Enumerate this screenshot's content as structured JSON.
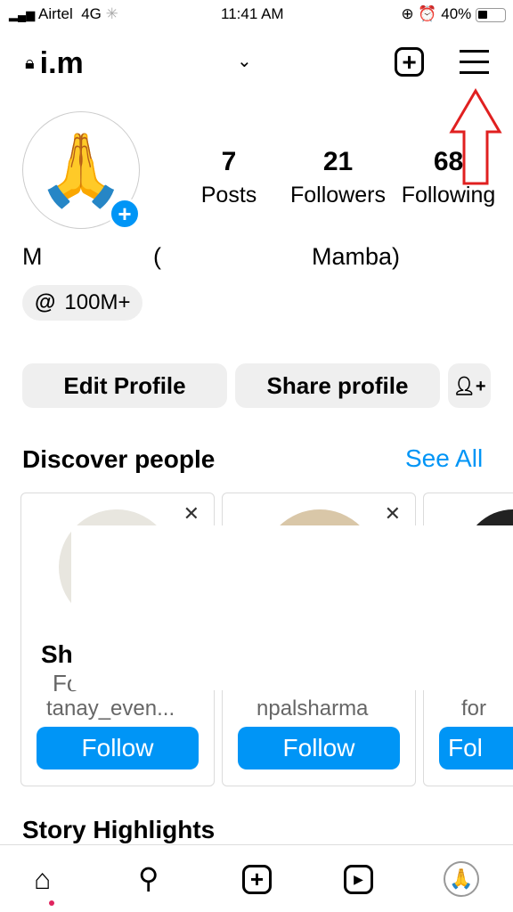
{
  "status": {
    "carrier": "Airtel",
    "network": "4G",
    "time": "11:41 AM",
    "battery": "40%"
  },
  "header": {
    "username": "i.m",
    "menu_icon": "hamburger-icon",
    "create_icon": "plus-square-icon"
  },
  "stats": [
    {
      "value": "7",
      "label": "Posts"
    },
    {
      "value": "21",
      "label": "Followers"
    },
    {
      "value": "68",
      "label": "Following"
    }
  ],
  "profile": {
    "name_left": "M",
    "name_paren": "(",
    "name_right": "Mamba)",
    "threads_badge": "100M+"
  },
  "buttons": {
    "edit": "Edit Profile",
    "share": "Share profile"
  },
  "discover": {
    "title": "Discover people",
    "see_all": "See All",
    "cards": [
      {
        "name": "Sh",
        "subtitle": "Fo",
        "username": "tanay_even...",
        "follow": "Follow"
      },
      {
        "name": "",
        "subtitle": "",
        "username": "npalsharma",
        "follow": "Follow"
      },
      {
        "name": "",
        "subtitle": "",
        "username": "for",
        "follow": "Fol"
      }
    ]
  },
  "highlights": {
    "title": "Story Highlights"
  },
  "colors": {
    "accent": "#0095f6",
    "annotation": "#e02020"
  }
}
